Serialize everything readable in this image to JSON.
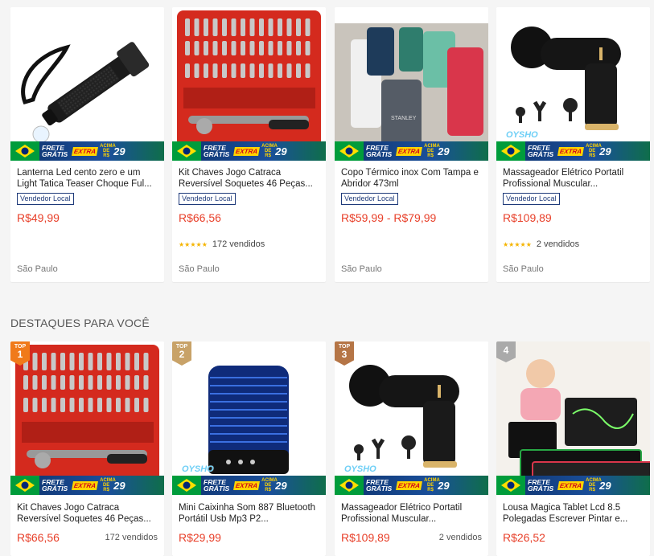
{
  "banner": {
    "frete": "FRETE GRÁTIS",
    "extra": "EXTRA",
    "acima": "ACIMA DE R$",
    "value": "29"
  },
  "row1": [
    {
      "title": "Lanterna Led cento zero e um Light Tatica Teaser Choque Ful...",
      "badge": "Vendedor Local",
      "price": "R$49,99",
      "stars": "★★★★★",
      "sold": "",
      "location": "São Paulo"
    },
    {
      "title": "Kit Chaves Jogo Catraca Reversível Soquetes 46 Peças...",
      "badge": "Vendedor Local",
      "price": "R$66,56",
      "stars": "★★★★★",
      "sold": "172 vendidos",
      "location": "São Paulo"
    },
    {
      "title": "Copo Térmico inox Com Tampa e Abridor 473ml",
      "badge": "Vendedor Local",
      "price": "R$59,99 - R$79,99",
      "stars": "",
      "sold": "",
      "location": "São Paulo"
    },
    {
      "title": "Massageador Elétrico Portatil Profissional Muscular...",
      "badge": "Vendedor Local",
      "price": "R$109,89",
      "stars": "★★★★★",
      "sold": "2 vendidos",
      "location": "São Paulo",
      "watermark": "OYSHO"
    }
  ],
  "section": {
    "title": "DESTAQUES PARA VOCÊ"
  },
  "row2": [
    {
      "rank_label": "TOP",
      "rank": "1",
      "title": "Kit Chaves Jogo Catraca Reversível Soquetes 46 Peças...",
      "price": "R$66,56",
      "sold": "172 vendidos"
    },
    {
      "rank_label": "TOP",
      "rank": "2",
      "title": "Mini Caixinha Som 887 Bluetooth Portátil Usb Mp3 P2...",
      "price": "R$29,99",
      "sold": "",
      "watermark": "OYSHO"
    },
    {
      "rank_label": "TOP",
      "rank": "3",
      "title": "Massageador Elétrico Portatil Profissional Muscular...",
      "price": "R$109,89",
      "sold": "2 vendidos",
      "watermark": "OYSHO"
    },
    {
      "rank_label": "",
      "rank": "4",
      "title": "Lousa Magica Tablet Lcd 8.5 Polegadas Escrever Pintar e...",
      "price": "R$26,52",
      "sold": ""
    }
  ],
  "colors": {
    "price": "#e8402a",
    "badge": "#1e3a7a",
    "star": "#f5b400",
    "top1": "#f07a1a",
    "top2": "#c8a268",
    "top3": "#b57546"
  }
}
